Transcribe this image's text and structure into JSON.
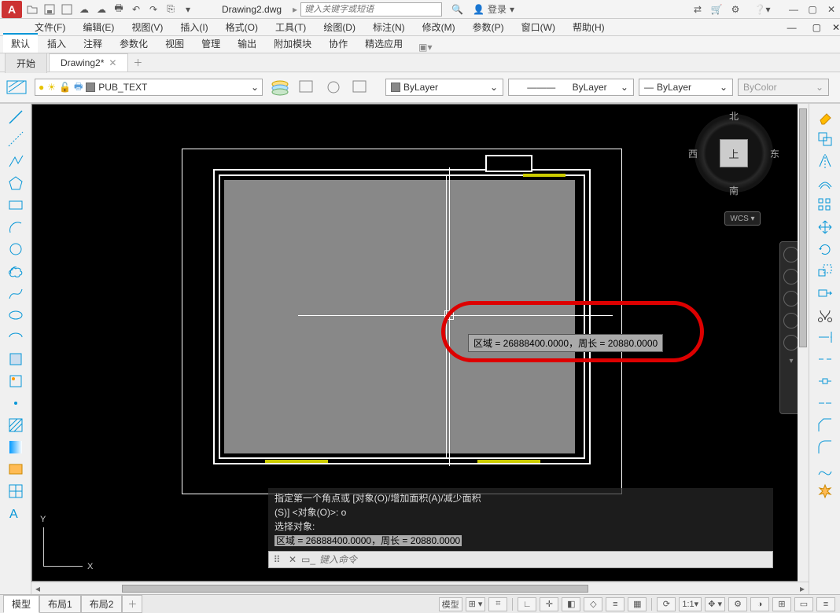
{
  "qat": {
    "filename": "Drawing2.dwg",
    "search_placeholder": "键入关键字或短语",
    "login_label": "登录"
  },
  "menubar": {
    "items": [
      "文件(F)",
      "编辑(E)",
      "视图(V)",
      "插入(I)",
      "格式(O)",
      "工具(T)",
      "绘图(D)",
      "标注(N)",
      "修改(M)",
      "参数(P)",
      "窗口(W)",
      "帮助(H)"
    ]
  },
  "ribbon": {
    "tabs": [
      "默认",
      "插入",
      "注释",
      "参数化",
      "视图",
      "管理",
      "输出",
      "附加模块",
      "协作",
      "精选应用"
    ]
  },
  "docTabs": {
    "home": "开始",
    "current": "Drawing2*"
  },
  "layer": {
    "name": "PUB_TEXT"
  },
  "props": {
    "linetype": "ByLayer",
    "lineweight": "ByLayer",
    "plotstyle": "ByLayer",
    "color": "ByColor"
  },
  "viewcube": {
    "north": "北",
    "south": "南",
    "east": "东",
    "west": "西",
    "top": "上",
    "wcs": "WCS ▾"
  },
  "tooltip": "区域 = 26888400.0000，周长 = 20880.0000",
  "command": {
    "line1": "指定第一个角点或 [对象(O)/增加面积(A)/减少面积",
    "line2": "(S)] <对象(O)>: o",
    "line3": "选择对象:",
    "line4": "区域 = 26888400.0000，周长 = 20880.0000",
    "input_placeholder": "键入命令"
  },
  "layoutTabs": {
    "model": "模型",
    "layout1": "布局1",
    "layout2": "布局2"
  },
  "statusRight": {
    "model": "模型",
    "scale": "1:1",
    "ucs_axes": {
      "x": "X",
      "y": "Y"
    }
  },
  "chart_data": {
    "type": "annotation",
    "area": 26888400.0,
    "perimeter": 20880.0
  }
}
